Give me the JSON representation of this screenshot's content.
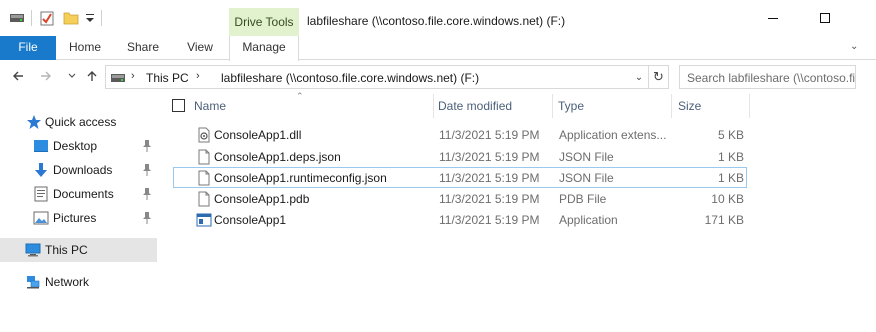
{
  "window": {
    "contextual_tab": "Drive Tools",
    "title": "labfileshare (\\\\contoso.file.core.windows.net) (F:)"
  },
  "ribbon": {
    "tabs": [
      "File",
      "Home",
      "Share",
      "View",
      "Manage"
    ]
  },
  "address": {
    "crumbs": [
      "This PC",
      "labfileshare (\\\\contoso.file.core.windows.net) (F:)"
    ],
    "search_placeholder": "Search labfileshare (\\\\contoso.file.core.windows.net) (F:)"
  },
  "nav": {
    "quick_access": "Quick access",
    "pinned": [
      "Desktop",
      "Downloads",
      "Documents",
      "Pictures"
    ],
    "this_pc": "This PC",
    "network": "Network"
  },
  "columns": {
    "name": "Name",
    "date": "Date modified",
    "type": "Type",
    "size": "Size"
  },
  "files": [
    {
      "name": "ConsoleApp1.dll",
      "date": "11/3/2021 5:19 PM",
      "type": "Application extens...",
      "size": "5 KB",
      "icon": "dll-file-icon"
    },
    {
      "name": "ConsoleApp1.deps.json",
      "date": "11/3/2021 5:19 PM",
      "type": "JSON File",
      "size": "1 KB",
      "icon": "json-file-icon"
    },
    {
      "name": "ConsoleApp1.runtimeconfig.json",
      "date": "11/3/2021 5:19 PM",
      "type": "JSON File",
      "size": "1 KB",
      "icon": "json-file-icon"
    },
    {
      "name": "ConsoleApp1.pdb",
      "date": "11/3/2021 5:19 PM",
      "type": "PDB File",
      "size": "10 KB",
      "icon": "pdb-file-icon"
    },
    {
      "name": "ConsoleApp1",
      "date": "11/3/2021 5:19 PM",
      "type": "Application",
      "size": "171 KB",
      "icon": "application-icon"
    }
  ],
  "colors": {
    "file_tab": "#1979ca",
    "contextual_tab": "#e2f2cf",
    "selection": "#e5e5e5",
    "focus_border": "#99c9ef"
  }
}
